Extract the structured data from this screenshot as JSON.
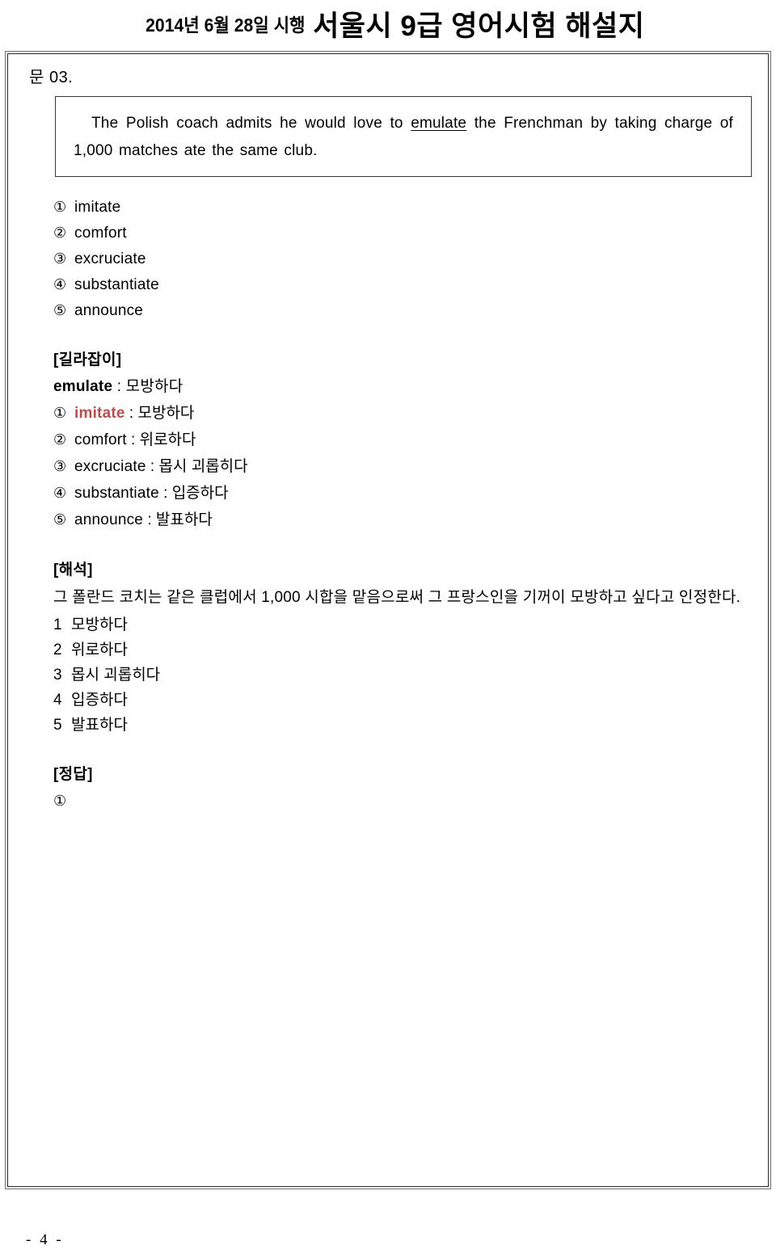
{
  "header": {
    "date_prefix": "2014년 6월 28일 시행",
    "title": "서울시 9급 영어시험 해설지"
  },
  "question": {
    "label": "문 03.",
    "passage_before": "The Polish coach admits he would love to ",
    "passage_underlined": "emulate",
    "passage_after": " the Frenchman by taking charge of 1,000 matches ate the same club.",
    "choices": [
      {
        "num": "①",
        "text": "imitate"
      },
      {
        "num": "②",
        "text": "comfort"
      },
      {
        "num": "③",
        "text": "excruciate"
      },
      {
        "num": "④",
        "text": "substantiate"
      },
      {
        "num": "⑤",
        "text": "announce"
      }
    ]
  },
  "guide": {
    "section_title": "[길라잡이]",
    "headword": "emulate",
    "headword_sep": " : ",
    "headword_meaning": "모방하다",
    "entries": [
      {
        "num": "①",
        "term": "imitate",
        "sep": " : ",
        "meaning": "모방하다",
        "highlight": true
      },
      {
        "num": "②",
        "term": "comfort",
        "sep": " : ",
        "meaning": "위로하다",
        "highlight": false
      },
      {
        "num": "③",
        "term": "excruciate",
        "sep": " : ",
        "meaning": "몹시 괴롭히다",
        "highlight": false
      },
      {
        "num": "④",
        "term": "substantiate",
        "sep": " : ",
        "meaning": "입증하다",
        "highlight": false
      },
      {
        "num": "⑤",
        "term": "announce",
        "sep": " : ",
        "meaning": "발표하다",
        "highlight": false
      }
    ]
  },
  "translation": {
    "section_title": "[해석]",
    "body": "그 폴란드 코치는 같은 클럽에서 1,000 시합을 맡음으로써 그 프랑스인을 기꺼이 모방하고 싶다고 인정한다.",
    "items": [
      {
        "num": "1",
        "text": "모방하다"
      },
      {
        "num": "2",
        "text": "위로하다"
      },
      {
        "num": "3",
        "text": "몹시 괴롭히다"
      },
      {
        "num": "4",
        "text": "입증하다"
      },
      {
        "num": "5",
        "text": "발표하다"
      }
    ]
  },
  "answer": {
    "section_title": "[정답]",
    "value": "①"
  },
  "footer": {
    "page_number": "- 4 -"
  },
  "colors": {
    "highlight": "#b5504f",
    "text": "#000000",
    "border_outer": "#6f6f6f",
    "border_inner": "#2b2b2b"
  }
}
